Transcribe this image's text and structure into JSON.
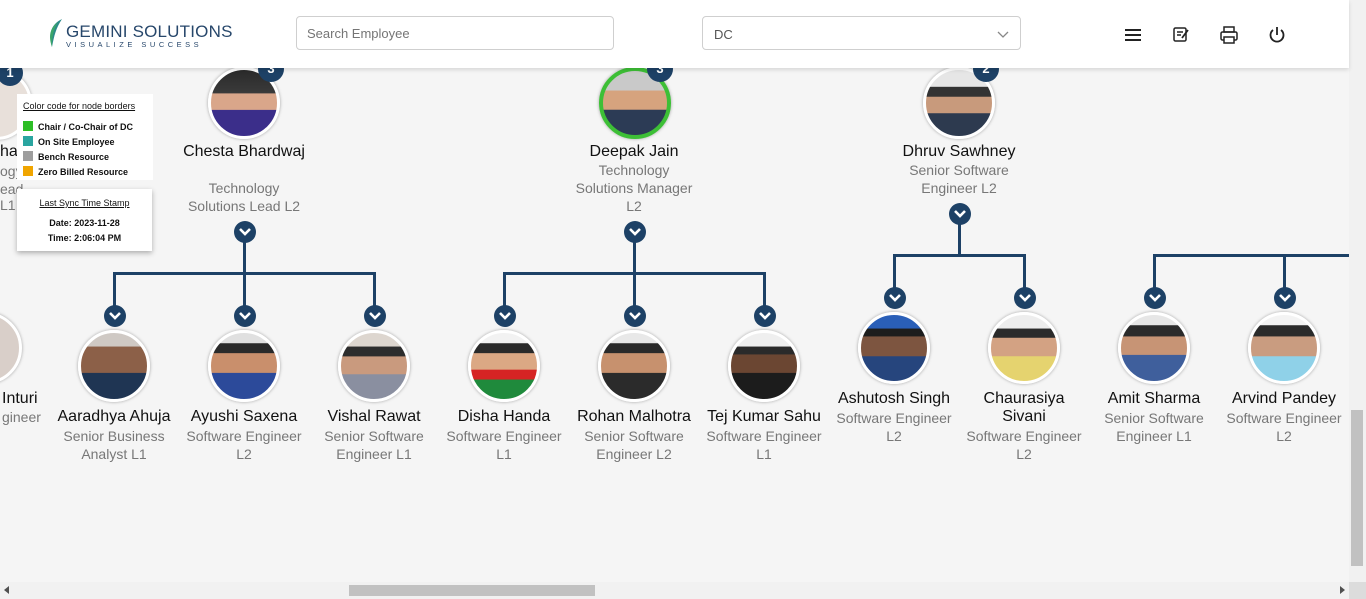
{
  "header": {
    "logo_brand": "GEMINI SOLUTIONS",
    "logo_tagline": "VISUALIZE SUCCESS",
    "search_placeholder": "Search Employee",
    "dc_selected": "DC",
    "icons": [
      "menu-icon",
      "report-icon",
      "print-icon",
      "power-icon"
    ]
  },
  "legend": {
    "title": "Color code for node borders",
    "items": [
      {
        "label": "Chair / Co-Chair of DC",
        "color": "#2dbe26"
      },
      {
        "label": "On Site Employee",
        "color": "#2aa5a0"
      },
      {
        "label": "Bench Resource",
        "color": "#9e9e9e"
      },
      {
        "label": "Zero Billed Resource",
        "color": "#f0a500"
      }
    ]
  },
  "sync": {
    "title": "Last Sync Time Stamp",
    "date": "Date: 2023-11-28",
    "time": "Time: 2:06:04 PM"
  },
  "colors": {
    "primary": "#1d4166",
    "chair_border": "#3dbf36"
  },
  "partial_left": {
    "top_badge": "1",
    "top_name": "ha",
    "top_title_1": "ogy",
    "top_title_2": "ead L1",
    "bottom_name": "Inturi",
    "bottom_title": "gineer"
  },
  "managers": [
    {
      "name": "Chesta Bhardwaj",
      "title": "Technology Solutions Lead L2",
      "badge": "3"
    },
    {
      "name": "Deepak Jain",
      "title": "Technology Solutions Manager L2",
      "badge": "3"
    },
    {
      "name": "Dhruv Sawhney",
      "title": "Senior Software Engineer L2",
      "badge": "2"
    }
  ],
  "employees": [
    {
      "name": "Aaradhya Ahuja",
      "title": "Senior Business Analyst L1"
    },
    {
      "name": "Ayushi Saxena",
      "title": "Software Engineer L2"
    },
    {
      "name": "Vishal Rawat",
      "title": "Senior Software Engineer L1"
    },
    {
      "name": "Disha Handa",
      "title": "Software Engineer L1"
    },
    {
      "name": "Rohan Malhotra",
      "title": "Senior Software Engineer L2"
    },
    {
      "name": "Tej Kumar Sahu",
      "title": "Software Engineer L1"
    },
    {
      "name": "Ashutosh Singh",
      "title": "Software Engineer L2"
    },
    {
      "name": "Chaurasiya Sivani",
      "title": "Software Engineer L2"
    },
    {
      "name": "Amit Sharma",
      "title": "Senior Software Engineer L1"
    },
    {
      "name": "Arvind Pandey",
      "title": "Software Engineer L2"
    }
  ]
}
